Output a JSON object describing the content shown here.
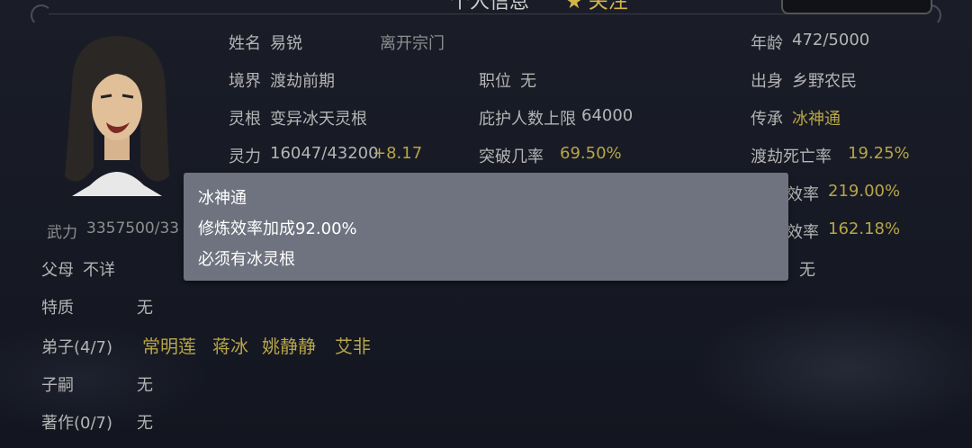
{
  "header": {
    "title": "个人信息",
    "follow_label": "关注"
  },
  "stats": {
    "name_label": "姓名",
    "name_value": "易锐",
    "leave_sect": "离开宗门",
    "age_label": "年龄",
    "age_value": "472/5000",
    "realm_label": "境界",
    "realm_value": "渡劫前期",
    "position_label": "职位",
    "position_value": "无",
    "origin_label": "出身",
    "origin_value": "乡野农民",
    "root_label": "灵根",
    "root_value": "变异冰天灵根",
    "protect_label": "庇护人数上限",
    "protect_value": "64000",
    "inherit_label": "传承",
    "inherit_value": "冰神通",
    "spirit_label": "灵力",
    "spirit_value": "16047/43200",
    "spirit_bonus": "+8.17",
    "break_label": "突破几率",
    "break_value": "69.50%",
    "death_label": "渡劫死亡率",
    "death_value": "19.25%",
    "eff1_label": "效率",
    "eff1_value": "219.00%",
    "eff2_label": "效率",
    "eff2_value": "162.18%",
    "right_none": "无",
    "force_label": "武力",
    "force_value": "3357500/33"
  },
  "details": {
    "parents_label": "父母",
    "parents_value": "不详",
    "trait_label": "特质",
    "trait_value": "无",
    "disciples_label": "弟子(4/7)",
    "disciples": [
      "常明莲",
      "蒋冰",
      "姚静静",
      "艾非"
    ],
    "heir_label": "子嗣",
    "heir_value": "无",
    "works_label": "著作(0/7)",
    "works_value": "无"
  },
  "tooltip": {
    "title": "冰神通",
    "line1": "修炼效率加成92.00%",
    "line2": "必须有冰灵根"
  },
  "colors": {
    "gold": "#b7a548",
    "text": "#b4b4b4",
    "tooltip_bg": "#6f737f"
  }
}
